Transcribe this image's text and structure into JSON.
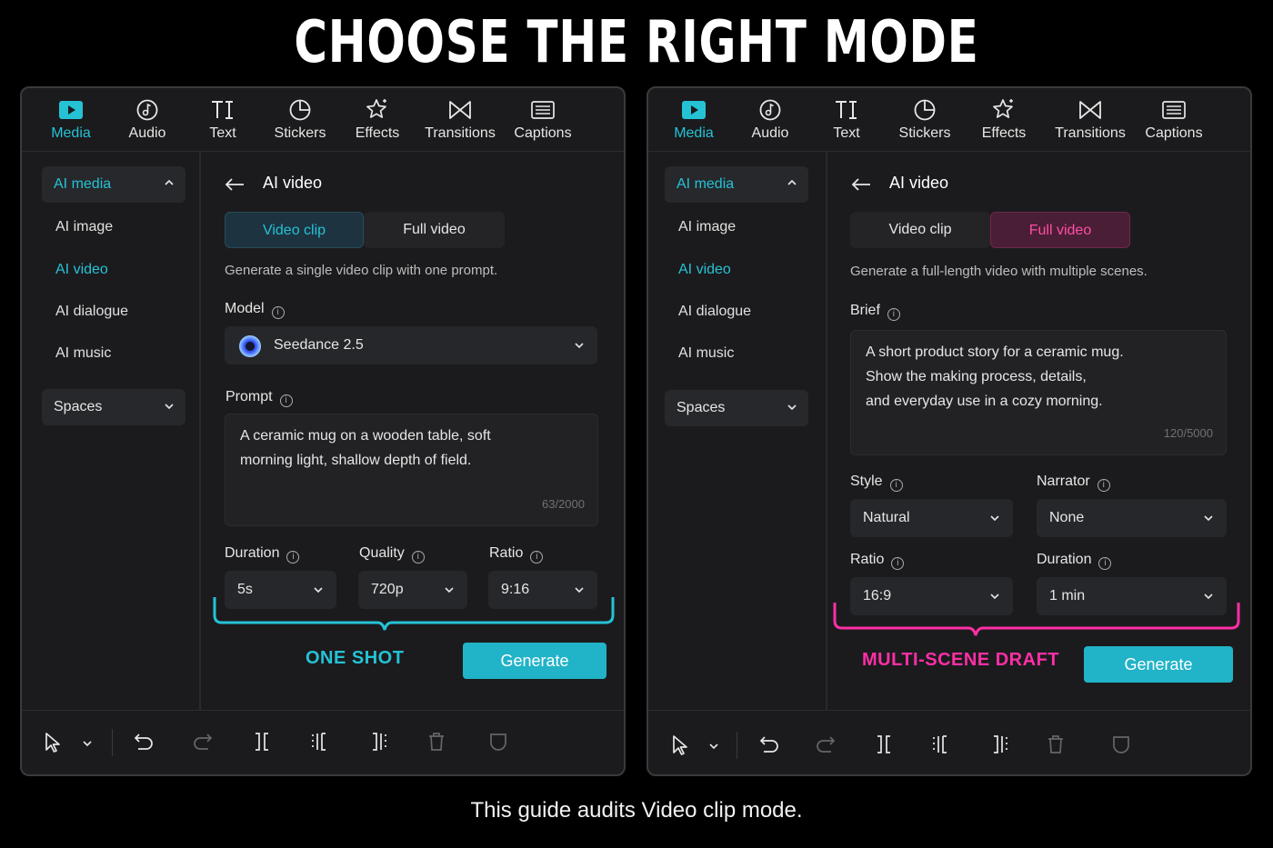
{
  "title": "CHOOSE THE RIGHT MODE",
  "footer": "This guide audits Video clip mode.",
  "colors": {
    "accent_cyan": "#25c2d6",
    "accent_pink": "#ff2fa6",
    "generate": "#21b3c8",
    "panel_bg": "#1b1b1d"
  },
  "toolbar": [
    {
      "label": "Media",
      "icon": "media-icon"
    },
    {
      "label": "Audio",
      "icon": "audio-icon"
    },
    {
      "label": "Text",
      "icon": "text-icon"
    },
    {
      "label": "Stickers",
      "icon": "stickers-icon"
    },
    {
      "label": "Effects",
      "icon": "effects-icon"
    },
    {
      "label": "Transitions",
      "icon": "transitions-icon"
    },
    {
      "label": "Captions",
      "icon": "captions-icon"
    }
  ],
  "sidebar": {
    "head": "AI media",
    "items": [
      "AI image",
      "AI video",
      "AI dialogue",
      "AI music"
    ],
    "spaces": "Spaces"
  },
  "left": {
    "header": "AI video",
    "tabs": [
      "Video clip",
      "Full video"
    ],
    "description": "Generate a single video clip with one prompt.",
    "model_label": "Model",
    "model_value": "Seedance 2.5",
    "prompt_label": "Prompt",
    "prompt_line1": "A ceramic mug on a wooden table, soft",
    "prompt_line2": "morning light, shallow depth of field.",
    "prompt_counter": "63/2000",
    "duration_label": "Duration",
    "duration_value": "5s",
    "quality_label": "Quality",
    "quality_value": "720p",
    "ratio_label": "Ratio",
    "ratio_value": "9:16",
    "tag": "ONE SHOT",
    "generate": "Generate"
  },
  "right": {
    "header": "AI video",
    "tabs": [
      "Video clip",
      "Full video"
    ],
    "description": "Generate a full-length video with multiple scenes.",
    "brief_label": "Brief",
    "brief_line1": "A short product story for a ceramic mug.",
    "brief_line2": "Show the making process, details,",
    "brief_line3": "and everyday use in a cozy morning.",
    "brief_counter": "120/5000",
    "style_label": "Style",
    "style_value": "Natural",
    "narrator_label": "Narrator",
    "narrator_value": "None",
    "ratio_label": "Ratio",
    "ratio_value": "16:9",
    "duration_label": "Duration",
    "duration_value": "1 min",
    "tag": "MULTI-SCENE DRAFT",
    "generate": "Generate"
  }
}
